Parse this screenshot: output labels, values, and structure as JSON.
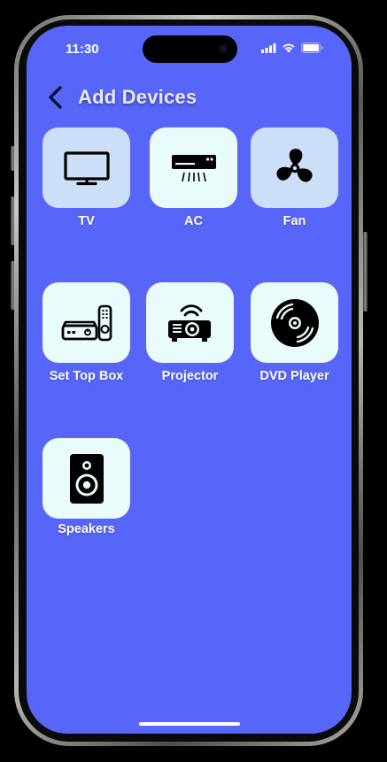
{
  "status_bar": {
    "time": "11:30",
    "icons": [
      "cellular-signal-icon",
      "wifi-icon",
      "battery-icon"
    ]
  },
  "header": {
    "back_icon": "chevron-left-icon",
    "title": "Add Devices"
  },
  "colors": {
    "screen_background": "#5766f8",
    "tile_light": "#e9fbfb",
    "tile_selected": "#cddff8",
    "icon": "#000000",
    "label": "#ffffff"
  },
  "devices": [
    {
      "label": "TV",
      "icon": "tv-icon",
      "highlighted": true
    },
    {
      "label": "AC",
      "icon": "air-conditioner-icon",
      "highlighted": false
    },
    {
      "label": "Fan",
      "icon": "fan-icon",
      "highlighted": true
    },
    {
      "label": "Set Top Box",
      "icon": "set-top-box-icon",
      "highlighted": false
    },
    {
      "label": "Projector",
      "icon": "projector-icon",
      "highlighted": false
    },
    {
      "label": "DVD Player",
      "icon": "dvd-icon",
      "highlighted": false
    },
    {
      "label": "Speakers",
      "icon": "speaker-icon",
      "highlighted": false
    }
  ]
}
